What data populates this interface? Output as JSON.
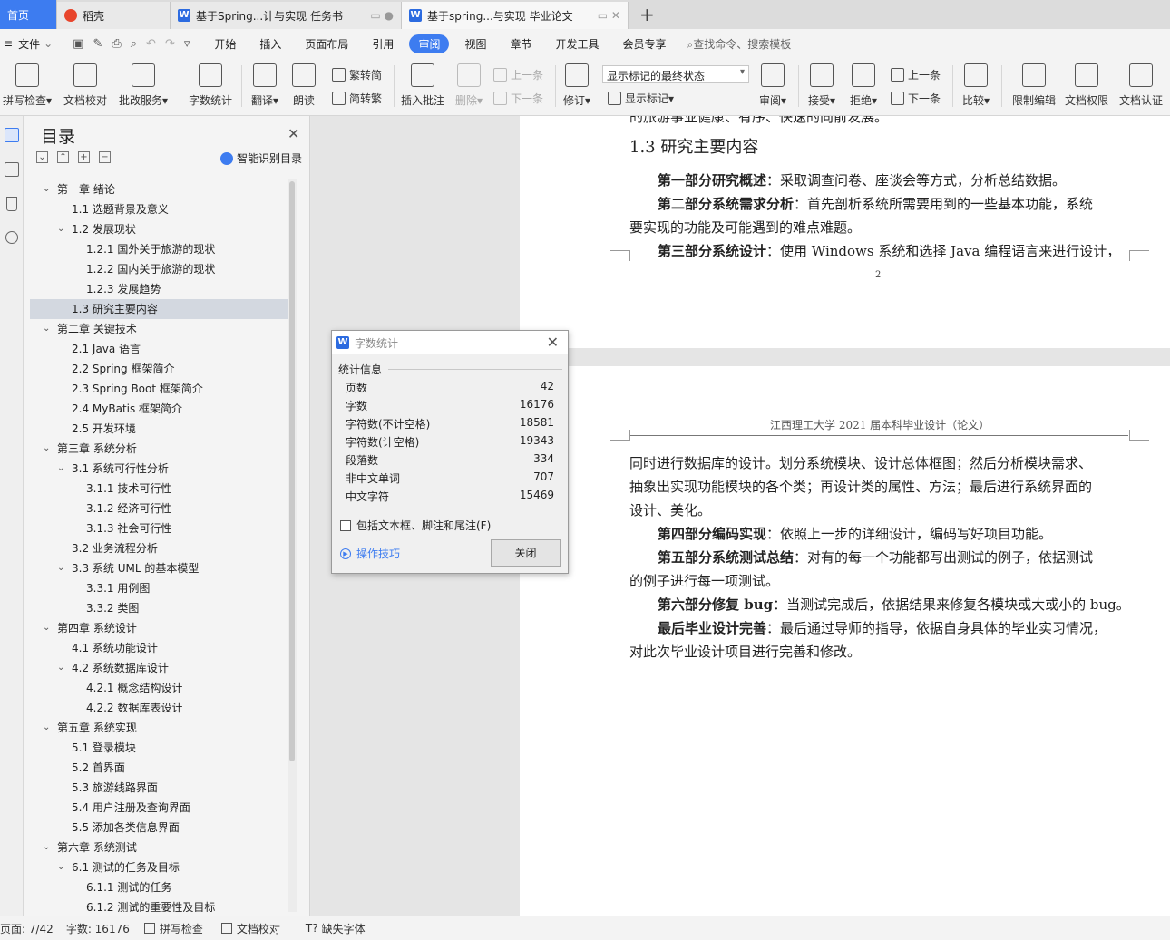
{
  "tabs": [
    {
      "label": "首页",
      "icon": "home-icon"
    },
    {
      "label": "稻壳",
      "icon": "docer-icon"
    },
    {
      "label": "基于Spring...计与实现 任务书",
      "icon": "wps-doc-icon"
    },
    {
      "label": "基于spring...与实现 毕业论文",
      "icon": "wps-doc-icon"
    }
  ],
  "menubar": {
    "file_label": "文件",
    "items": [
      "开始",
      "插入",
      "页面布局",
      "引用",
      "审阅",
      "视图",
      "章节",
      "开发工具",
      "会员专享"
    ],
    "active": "审阅",
    "search_placeholder": "查找命令、搜索模板"
  },
  "ribbon": {
    "spell_check": "拼写检查",
    "doc_proof": "文档校对",
    "review_service": "批改服务",
    "word_count": "字数统计",
    "translate": "翻译",
    "read_aloud": "朗读",
    "trad_simp_to": "繁转简",
    "simp_trad_to": "简转繁",
    "insert_comment": "插入批注",
    "delete": "删除",
    "prev_comment": "上一条",
    "next_comment": "下一条",
    "track_changes": "修订",
    "display_state": "显示标记的最终状态",
    "show_markup": "显示标记",
    "review": "审阅",
    "accept": "接受",
    "reject": "拒绝",
    "prev_change": "上一条",
    "next_change": "下一条",
    "compare": "比较",
    "restrict_edit": "限制编辑",
    "doc_permission": "文档权限",
    "doc_cert": "文档认证"
  },
  "toc": {
    "title": "目录",
    "smart_label": "智能识别目录",
    "items": [
      {
        "label": "第一章  绪论",
        "level": 1,
        "arrow": true
      },
      {
        "label": "1.1 选题背景及意义",
        "level": 2,
        "arrow": false
      },
      {
        "label": "1.2 发展现状",
        "level": 2,
        "arrow": true
      },
      {
        "label": "1.2.1 国外关于旅游的现状",
        "level": 3,
        "arrow": false
      },
      {
        "label": "1.2.2 国内关于旅游的现状",
        "level": 3,
        "arrow": false
      },
      {
        "label": "1.2.3 发展趋势",
        "level": 3,
        "arrow": false
      },
      {
        "label": "1.3 研究主要内容",
        "level": 2,
        "arrow": false,
        "active": true
      },
      {
        "label": "第二章  关键技术",
        "level": 1,
        "arrow": true
      },
      {
        "label": "2.1 Java 语言",
        "level": 2,
        "arrow": false
      },
      {
        "label": "2.2 Spring 框架简介",
        "level": 2,
        "arrow": false
      },
      {
        "label": "2.3 Spring Boot 框架简介",
        "level": 2,
        "arrow": false
      },
      {
        "label": "2.4 MyBatis  框架简介",
        "level": 2,
        "arrow": false
      },
      {
        "label": "2.5  开发环境",
        "level": 2,
        "arrow": false
      },
      {
        "label": "第三章  系统分析",
        "level": 1,
        "arrow": true
      },
      {
        "label": "3.1  系统可行性分析",
        "level": 2,
        "arrow": true
      },
      {
        "label": "3.1.1  技术可行性",
        "level": 3,
        "arrow": false
      },
      {
        "label": "3.1.2  经济可行性",
        "level": 3,
        "arrow": false
      },
      {
        "label": "3.1.3  社会可行性",
        "level": 3,
        "arrow": false
      },
      {
        "label": "3.2  业务流程分析",
        "level": 2,
        "arrow": false
      },
      {
        "label": "3.3  系统 UML 的基本模型",
        "level": 2,
        "arrow": true
      },
      {
        "label": "3.3.1  用例图",
        "level": 3,
        "arrow": false
      },
      {
        "label": "3.3.2  类图",
        "level": 3,
        "arrow": false
      },
      {
        "label": "第四章  系统设计",
        "level": 1,
        "arrow": true
      },
      {
        "label": "4.1  系统功能设计",
        "level": 2,
        "arrow": false
      },
      {
        "label": "4.2  系统数据库设计",
        "level": 2,
        "arrow": true
      },
      {
        "label": "4.2.1  概念结构设计",
        "level": 3,
        "arrow": false
      },
      {
        "label": "4.2.2  数据库表设计",
        "level": 3,
        "arrow": false
      },
      {
        "label": "第五章  系统实现",
        "level": 1,
        "arrow": true
      },
      {
        "label": "5.1 登录模块",
        "level": 2,
        "arrow": false
      },
      {
        "label": "5.2  首界面",
        "level": 2,
        "arrow": false
      },
      {
        "label": "5.3  旅游线路界面",
        "level": 2,
        "arrow": false
      },
      {
        "label": "5.4  用户注册及查询界面",
        "level": 2,
        "arrow": false
      },
      {
        "label": "5.5  添加各类信息界面",
        "level": 2,
        "arrow": false
      },
      {
        "label": "第六章  系统测试",
        "level": 1,
        "arrow": true
      },
      {
        "label": "6.1 测试的任务及目标",
        "level": 2,
        "arrow": true
      },
      {
        "label": "6.1.1 测试的任务",
        "level": 3,
        "arrow": false
      },
      {
        "label": "6.1.2 测试的重要性及目标",
        "level": 3,
        "arrow": false
      }
    ]
  },
  "document": {
    "page1": {
      "top_fragment": "的旅游事业健康、有序、快速的向前发展。",
      "heading": "1.3 研究主要内容",
      "lines": [
        {
          "bold": "第一部分研究概述",
          "text": "：采取调查问卷、座谈会等方式，分析总结数据。",
          "indent": true
        },
        {
          "bold": "第二部分系统需求分析",
          "text": "：首先剖析系统所需要用到的一些基本功能，系统",
          "indent": true
        },
        {
          "bold": "",
          "text": "要实现的功能及可能遇到的难点难题。",
          "indent": false
        },
        {
          "bold": "第三部分系统设计",
          "text": "：使用 Windows 系统和选择 Java 编程语言来进行设计，",
          "indent": true
        }
      ],
      "page_number": "2"
    },
    "page2": {
      "header": "江西理工大学 2021 届本科毕业设计（论文）",
      "lines": [
        {
          "bold": "",
          "text": "同时进行数据库的设计。划分系统模块、设计总体框图；然后分析模块需求、",
          "indent": false
        },
        {
          "bold": "",
          "text": "抽象出实现功能模块的各个类；再设计类的属性、方法；最后进行系统界面的",
          "indent": false
        },
        {
          "bold": "",
          "text": "设计、美化。",
          "indent": false
        },
        {
          "bold": "第四部分编码实现",
          "text": "：依照上一步的详细设计，编码写好项目功能。",
          "indent": true
        },
        {
          "bold": "第五部分系统测试总结",
          "text": "：对有的每一个功能都写出测试的例子，依据测试",
          "indent": true
        },
        {
          "bold": "",
          "text": "的例子进行每一项测试。",
          "indent": false
        },
        {
          "bold": "第六部分修复 bug",
          "text": "：当测试完成后，依据结果来修复各模块或大或小的 bug。",
          "indent": true
        },
        {
          "bold": "最后毕业设计完善",
          "text": "：最后通过导师的指导，依据自身具体的毕业实习情况，",
          "indent": true
        },
        {
          "bold": "",
          "text": "对此次毕业设计项目进行完善和修改。",
          "indent": false
        }
      ]
    }
  },
  "dialog": {
    "title": "字数统计",
    "section": "统计信息",
    "rows": [
      {
        "label": "页数",
        "value": "42"
      },
      {
        "label": "字数",
        "value": "16176"
      },
      {
        "label": "字符数(不计空格)",
        "value": "18581"
      },
      {
        "label": "字符数(计空格)",
        "value": "19343"
      },
      {
        "label": "段落数",
        "value": "334"
      },
      {
        "label": "非中文单词",
        "value": "707"
      },
      {
        "label": "中文字符",
        "value": "15469"
      }
    ],
    "include_label": "包括文本框、脚注和尾注(F)",
    "tips_label": "操作技巧",
    "close_label": "关闭"
  },
  "statusbar": {
    "page": "页面: 7/42",
    "words": "字数: 16176",
    "spell": "拼写检查",
    "proof": "文档校对",
    "missing_font": "缺失字体"
  }
}
